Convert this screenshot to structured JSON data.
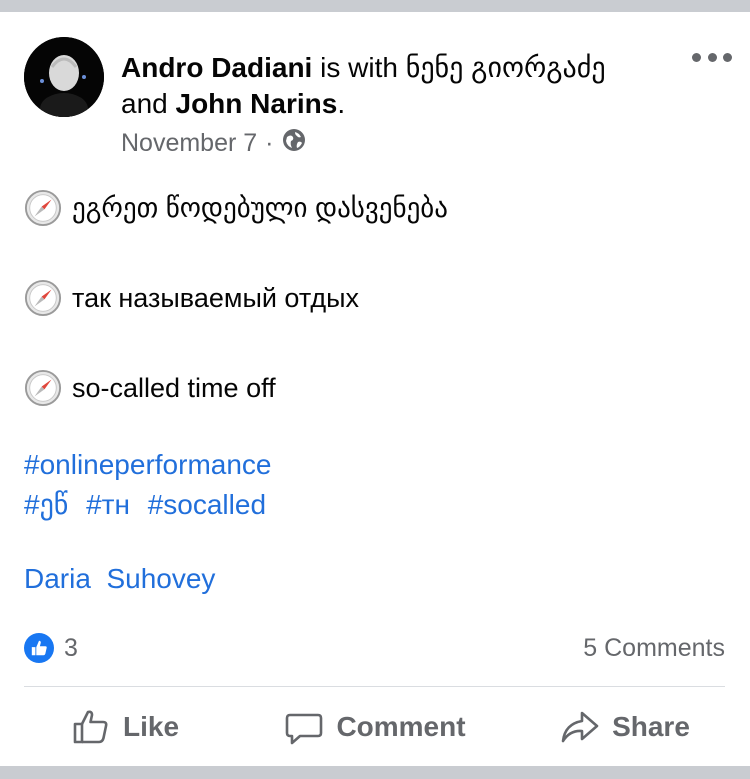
{
  "post": {
    "author": "Andro Dadiani",
    "with_text": " is with ",
    "tagged_friend_1": "ნენე გიორგაძე",
    "and_text": "and ",
    "tagged_friend_2": "John Narins",
    "period": ".",
    "date": "November 7",
    "dot": "·",
    "lines": [
      "ეგრეთ წოდებული დასვენება",
      "так называемый отдых",
      "so-called time off"
    ],
    "hashtags": [
      "#onlineperformance",
      "#ეწ",
      "#тн",
      "#socalled"
    ],
    "tagged_people": "Daria  Suhovey"
  },
  "stats": {
    "likes": "3",
    "comments": "5 Comments"
  },
  "actions": {
    "like": "Like",
    "comment": "Comment",
    "share": "Share"
  },
  "colors": {
    "link": "#216fdb",
    "muted": "#65676b",
    "like_blue": "#1877f2"
  },
  "icons": {
    "line_emoji": "compass-icon",
    "audience": "globe-icon"
  }
}
